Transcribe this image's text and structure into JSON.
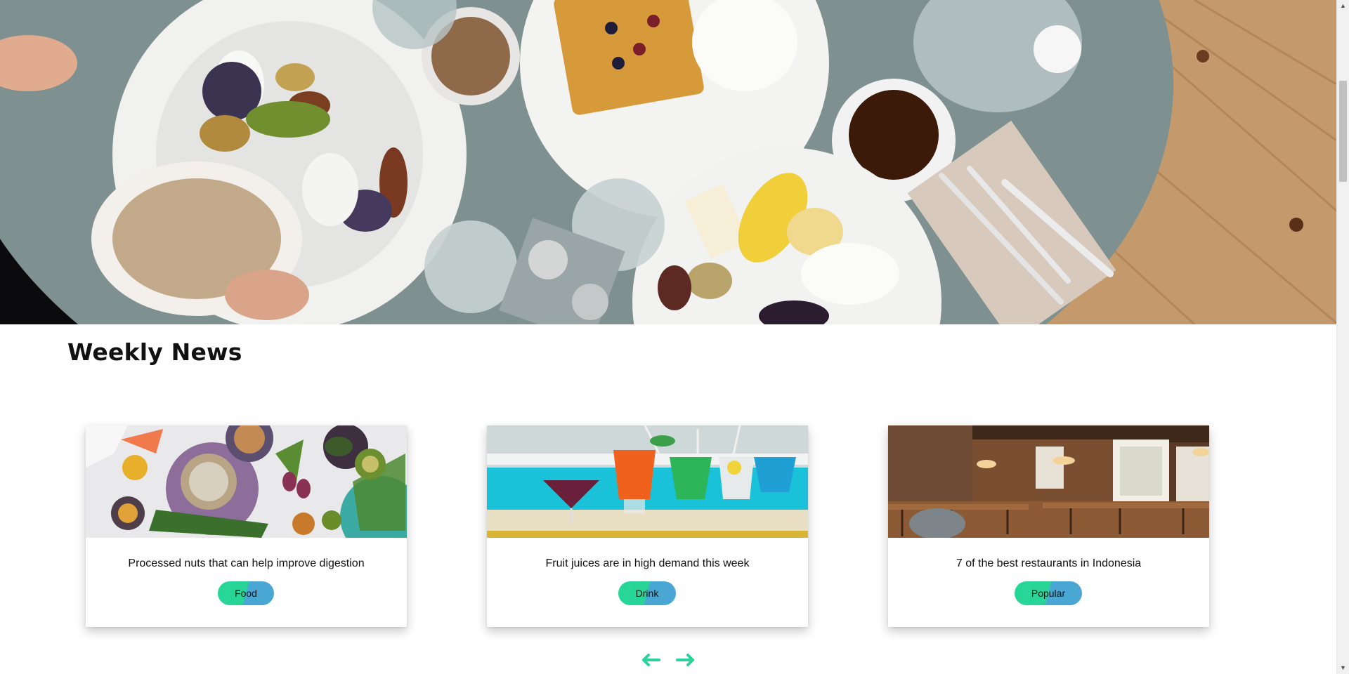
{
  "section": {
    "title": "Weekly News"
  },
  "cards": [
    {
      "title": "Processed nuts that can help improve digestion",
      "tag": "Food",
      "image": "healthy-food-bowls-photo"
    },
    {
      "title": "Fruit juices are in high demand this week",
      "tag": "Drink",
      "image": "colorful-cocktails-poolside-photo"
    },
    {
      "title": "7 of the best restaurants in Indonesia",
      "tag": "Popular",
      "image": "restaurant-interior-photo"
    }
  ],
  "carousel": {
    "prev_icon": "arrow-left-icon",
    "next_icon": "arrow-right-icon"
  },
  "hero": {
    "image": "breakfast-table-top-view-photo"
  },
  "colors": {
    "tag_gradient_start": "#26d79a",
    "tag_gradient_end": "#4aa7d4",
    "arrow": "#2bd39a",
    "title": "#111111"
  },
  "scrollbar": {
    "up_icon": "scroll-up-icon",
    "down_icon": "scroll-down-icon"
  }
}
